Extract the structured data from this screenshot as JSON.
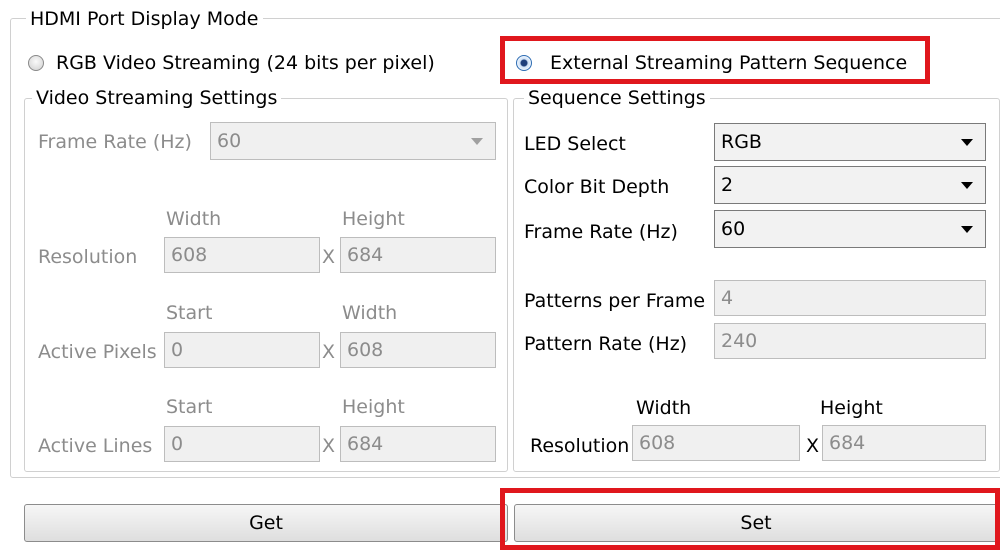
{
  "hdmi_mode": {
    "title": "HDMI Port Display Mode",
    "option_rgb": "RGB Video Streaming (24 bits per pixel)",
    "option_external": "External Streaming Pattern Sequence"
  },
  "video": {
    "title": "Video Streaming Settings",
    "frame_rate_label": "Frame Rate (Hz)",
    "frame_rate_value": "60",
    "resolution_label": "Resolution",
    "res_width_header": "Width",
    "res_height_header": "Height",
    "res_width": "608",
    "res_height": "684",
    "x_sep": "X",
    "active_pixels_label": "Active Pixels",
    "ap_start_header": "Start",
    "ap_width_header": "Width",
    "ap_start": "0",
    "ap_width": "608",
    "active_lines_label": "Active Lines",
    "al_start_header": "Start",
    "al_height_header": "Height",
    "al_start": "0",
    "al_height": "684"
  },
  "sequence": {
    "title": "Sequence Settings",
    "led_label": "LED Select",
    "led_value": "RGB",
    "depth_label": "Color Bit Depth",
    "depth_value": "2",
    "rate_label": "Frame Rate (Hz)",
    "rate_value": "60",
    "ppf_label": "Patterns per Frame",
    "ppf_value": "4",
    "prate_label": "Pattern Rate (Hz)",
    "prate_value": "240",
    "resolution_label": "Resolution",
    "width_header": "Width",
    "height_header": "Height",
    "width_value": "608",
    "height_value": "684",
    "x_sep": "X"
  },
  "actions": {
    "get_label": "Get",
    "set_label": "Set"
  },
  "colors": {
    "highlight": "#e0171d",
    "disabled_text": "#8c8c8c"
  }
}
